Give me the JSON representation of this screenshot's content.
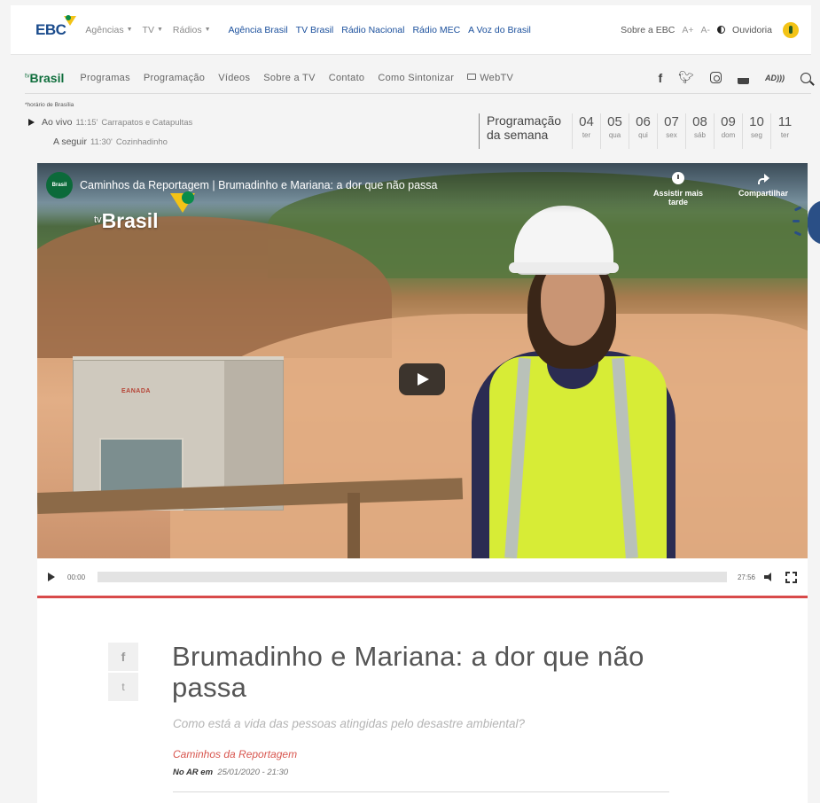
{
  "ebc": {
    "logo": "EBC",
    "menus": [
      "Agências",
      "TV",
      "Rádios"
    ],
    "links": [
      "Agência Brasil",
      "TV Brasil",
      "Rádio Nacional",
      "Rádio MEC",
      "A Voz do Brasil"
    ],
    "about": "Sobre a EBC",
    "font_plus": "A+",
    "font_minus": "A-",
    "ombudsman": "Ouvidoria"
  },
  "tvnav": {
    "logo_prefix": "tv",
    "logo": "Brasil",
    "items": [
      "Programas",
      "Programação",
      "Vídeos",
      "Sobre a TV",
      "Contato",
      "Como Sintonizar"
    ],
    "webtv": "WebTV",
    "social": {
      "ad": "AD"
    }
  },
  "schedule": {
    "timezone": "*horário de Brasília",
    "live_label": "Ao vivo",
    "live_time": "11:15'",
    "live_show": "Carrapatos e Catapultas",
    "next_label": "A seguir",
    "next_time": "11:30'",
    "next_show": "Cozinhadinho",
    "week_line1": "Programação",
    "week_line2": "da semana",
    "days": [
      {
        "num": "04",
        "wd": "ter"
      },
      {
        "num": "05",
        "wd": "qua"
      },
      {
        "num": "06",
        "wd": "qui"
      },
      {
        "num": "07",
        "wd": "sex"
      },
      {
        "num": "08",
        "wd": "sáb"
      },
      {
        "num": "09",
        "wd": "dom"
      },
      {
        "num": "10",
        "wd": "seg"
      },
      {
        "num": "11",
        "wd": "ter"
      }
    ]
  },
  "video": {
    "channel": "Brasil",
    "title": "Caminhos da Reportagem | Brumadinho e Mariana: a dor que não passa",
    "watch_later": "Assistir mais tarde",
    "share": "Compartilhar",
    "watermark_prefix": "tv",
    "watermark": "Brasil",
    "container_label": "EANADA",
    "time_current": "00:00",
    "time_total": "27:56"
  },
  "article": {
    "share_fb": "f",
    "share_tw": "t",
    "title": "Brumadinho e Mariana: a dor que não passa",
    "subtitle": "Como está a vida das pessoas atingidas pelo desastre ambiental?",
    "program": "Caminhos da Reportagem",
    "air_label": "No AR em",
    "air_date": "25/01/2020 - 21:30"
  }
}
